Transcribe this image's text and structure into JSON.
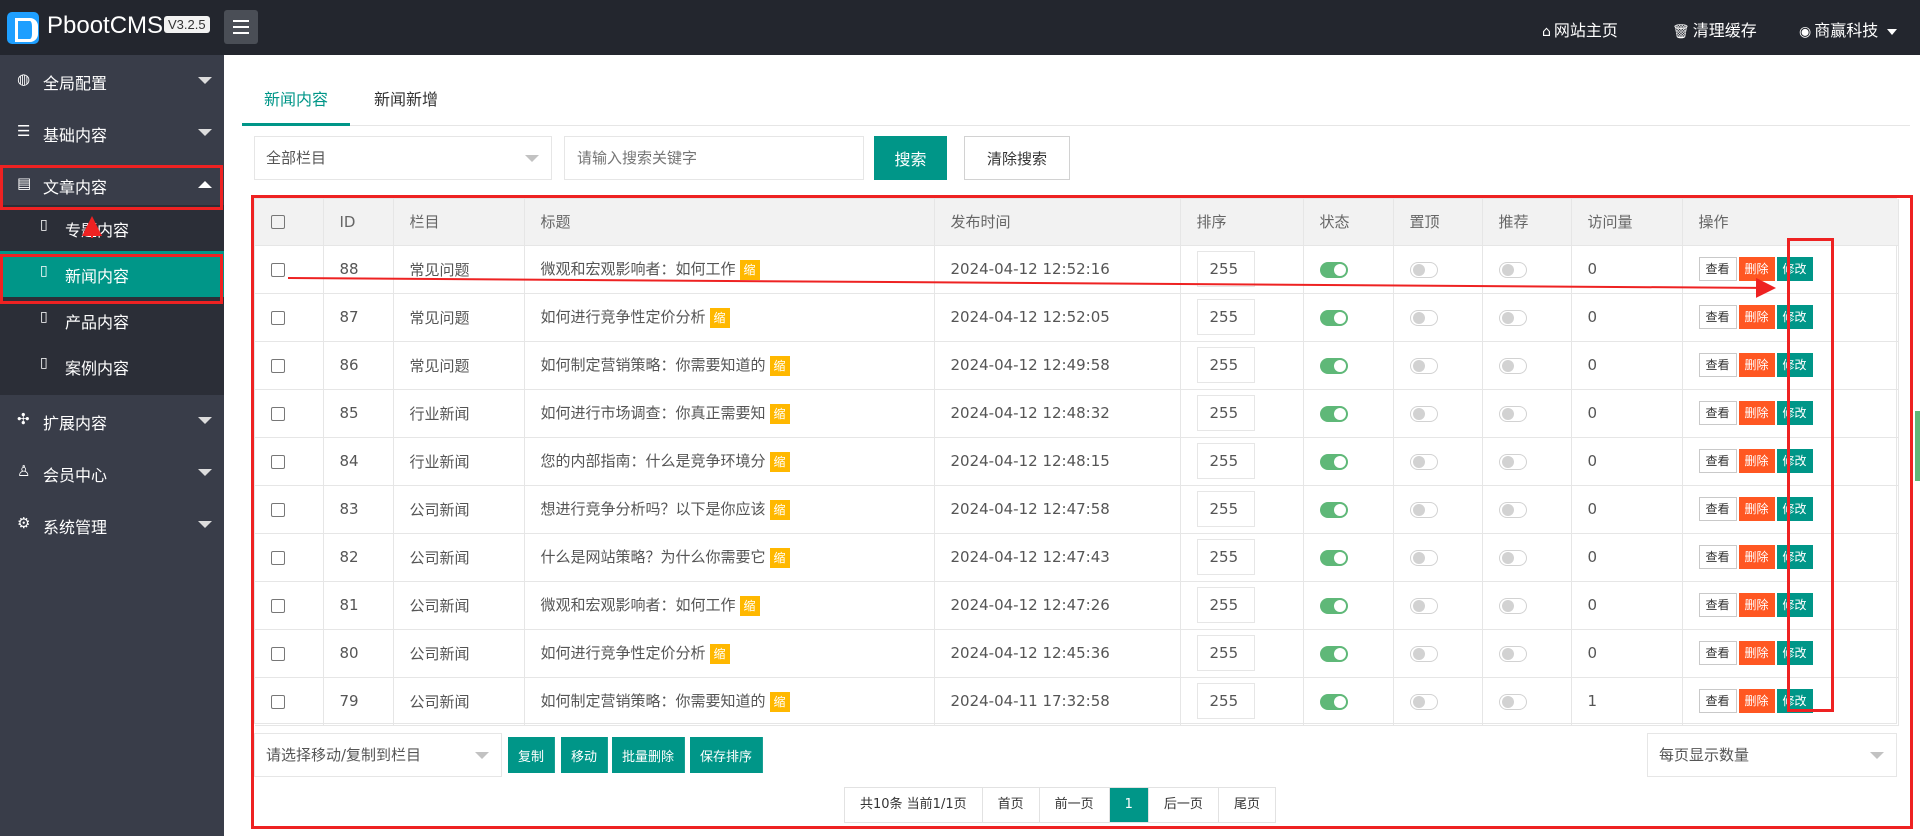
{
  "header": {
    "brand": "PbootCMS",
    "version": "V3.2.5",
    "links": [
      {
        "icon": "home-icon",
        "label": "网站主页"
      },
      {
        "icon": "trash-icon",
        "label": "清理缓存"
      },
      {
        "icon": "user-icon",
        "label": "商赢科技"
      }
    ]
  },
  "sidebar": {
    "items": [
      {
        "icon": "globe-icon",
        "label": "全局配置"
      },
      {
        "icon": "sliders-icon",
        "label": "基础内容"
      },
      {
        "icon": "document-icon",
        "label": "文章内容"
      },
      {
        "icon": "expand-icon",
        "label": "扩展内容"
      },
      {
        "icon": "user-icon",
        "label": "会员中心"
      },
      {
        "icon": "gear-icon",
        "label": "系统管理"
      }
    ],
    "sub_items": [
      {
        "icon": "file-icon",
        "label": "专题内容"
      },
      {
        "icon": "file-icon",
        "label": "新闻内容"
      },
      {
        "icon": "file-icon",
        "label": "产品内容"
      },
      {
        "icon": "file-icon",
        "label": "案例内容"
      }
    ]
  },
  "tabs": [
    "新闻内容",
    "新闻新增"
  ],
  "search": {
    "category": "全部栏目",
    "placeholder": "请输入搜索关键字",
    "search_label": "搜索",
    "clear_label": "清除搜索"
  },
  "table": {
    "headers": [
      "ID",
      "栏目",
      "标题",
      "发布时间",
      "排序",
      "状态",
      "置顶",
      "推荐",
      "访问量",
      "操作"
    ],
    "tag_label": "缩",
    "view_label": "查看",
    "delete_label": "删除",
    "edit_label": "修改",
    "rows": [
      {
        "id": "88",
        "category": "常见问题",
        "title": "微观和宏观影响者：如何工作",
        "date": "2024-04-12 12:52:16",
        "sort": "255",
        "visits": "0"
      },
      {
        "id": "87",
        "category": "常见问题",
        "title": "如何进行竞争性定价分析",
        "date": "2024-04-12 12:52:05",
        "sort": "255",
        "visits": "0"
      },
      {
        "id": "86",
        "category": "常见问题",
        "title": "如何制定营销策略：你需要知道的",
        "date": "2024-04-12 12:49:58",
        "sort": "255",
        "visits": "0"
      },
      {
        "id": "85",
        "category": "行业新闻",
        "title": "如何进行市场调查：你真正需要知",
        "date": "2024-04-12 12:48:32",
        "sort": "255",
        "visits": "0"
      },
      {
        "id": "84",
        "category": "行业新闻",
        "title": "您的内部指南：什么是竞争环境分",
        "date": "2024-04-12 12:48:15",
        "sort": "255",
        "visits": "0"
      },
      {
        "id": "83",
        "category": "公司新闻",
        "title": "想进行竞争分析吗？以下是你应该",
        "date": "2024-04-12 12:47:58",
        "sort": "255",
        "visits": "0"
      },
      {
        "id": "82",
        "category": "公司新闻",
        "title": "什么是网站策略？为什么你需要它",
        "date": "2024-04-12 12:47:43",
        "sort": "255",
        "visits": "0"
      },
      {
        "id": "81",
        "category": "公司新闻",
        "title": "微观和宏观影响者：如何工作",
        "date": "2024-04-12 12:47:26",
        "sort": "255",
        "visits": "0"
      },
      {
        "id": "80",
        "category": "公司新闻",
        "title": "如何进行竞争性定价分析",
        "date": "2024-04-12 12:45:36",
        "sort": "255",
        "visits": "0"
      },
      {
        "id": "79",
        "category": "公司新闻",
        "title": "如何制定营销策略：你需要知道的",
        "date": "2024-04-11 17:32:58",
        "sort": "255",
        "visits": "1"
      }
    ]
  },
  "bottom": {
    "move_select": "请选择移动/复制到栏目",
    "buttons": [
      "复制",
      "移动",
      "批量删除",
      "保存排序"
    ],
    "per_page": "每页显示数量"
  },
  "pager": {
    "summary": "共10条 当前1/1页",
    "first": "首页",
    "prev": "前一页",
    "current": "1",
    "next": "后一页",
    "last": "尾页"
  }
}
